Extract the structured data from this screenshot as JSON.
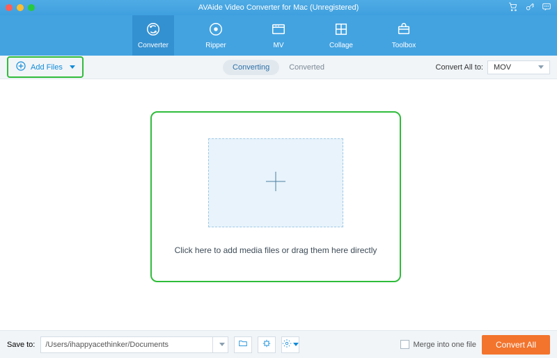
{
  "titlebar": {
    "title": "AVAide Video Converter for Mac (Unregistered)"
  },
  "nav": {
    "converter": "Converter",
    "ripper": "Ripper",
    "mv": "MV",
    "collage": "Collage",
    "toolbox": "Toolbox"
  },
  "subbar": {
    "add_files": "Add Files",
    "tab_converting": "Converting",
    "tab_converted": "Converted",
    "convert_all_to": "Convert All to:",
    "format": "MOV"
  },
  "main": {
    "drop_text": "Click here to add media files or drag them here directly"
  },
  "footer": {
    "save_to_label": "Save to:",
    "path": "/Users/ihappyacethinker/Documents",
    "merge_label": "Merge into one file",
    "convert_btn": "Convert All"
  }
}
